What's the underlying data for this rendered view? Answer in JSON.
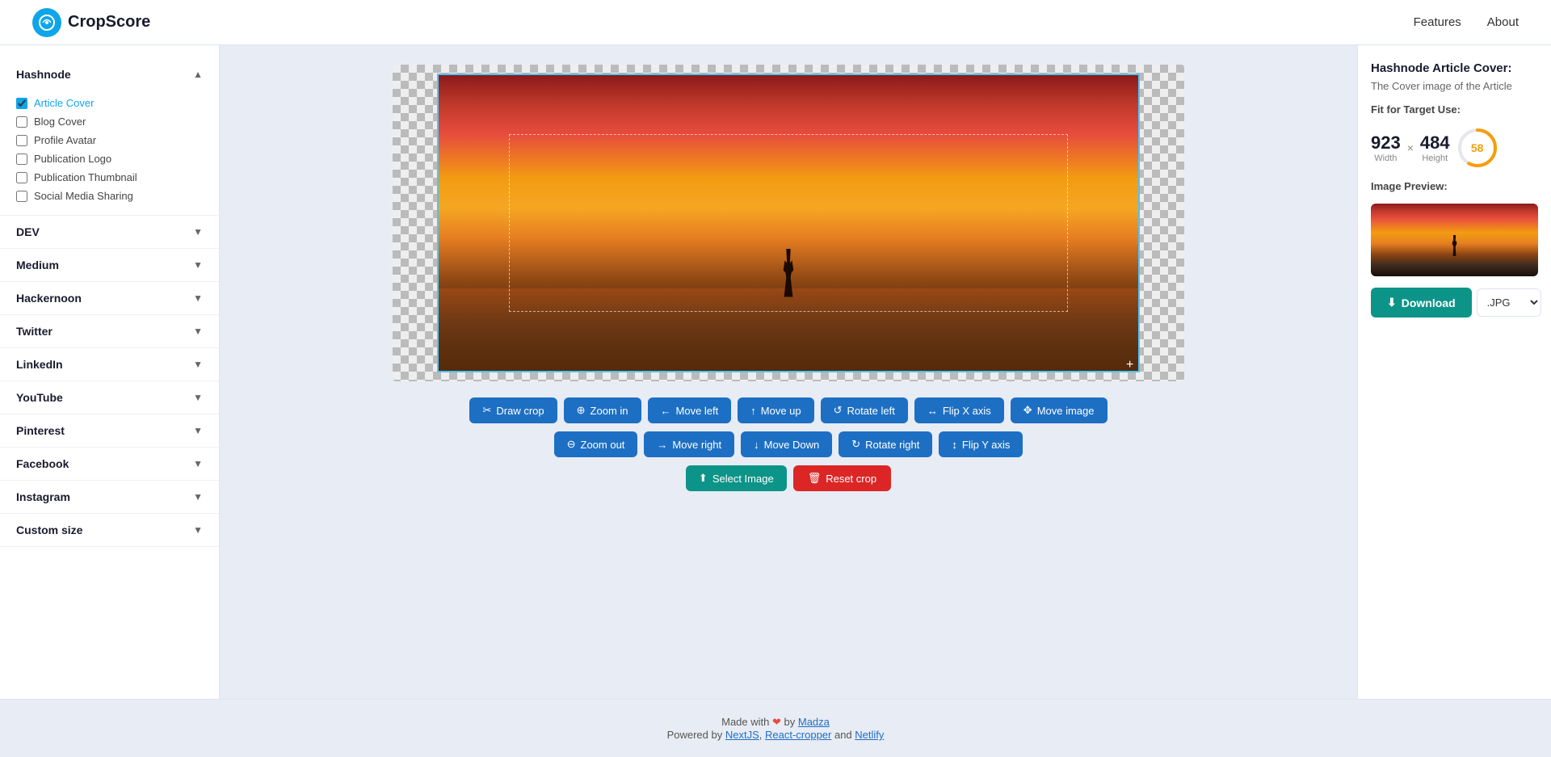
{
  "header": {
    "logo_text": "CropScore",
    "nav": [
      {
        "label": "Features",
        "id": "features"
      },
      {
        "label": "About",
        "id": "about"
      }
    ]
  },
  "sidebar": {
    "sections": [
      {
        "id": "hashnode",
        "label": "Hashnode",
        "expanded": true,
        "items": [
          {
            "label": "Article Cover",
            "checked": true
          },
          {
            "label": "Blog Cover",
            "checked": false
          },
          {
            "label": "Profile Avatar",
            "checked": false
          },
          {
            "label": "Publication Logo",
            "checked": false
          },
          {
            "label": "Publication Thumbnail",
            "checked": false
          },
          {
            "label": "Social Media Sharing",
            "checked": false
          }
        ]
      },
      {
        "id": "dev",
        "label": "DEV",
        "expanded": false,
        "items": []
      },
      {
        "id": "medium",
        "label": "Medium",
        "expanded": false,
        "items": []
      },
      {
        "id": "hackernoon",
        "label": "Hackernoon",
        "expanded": false,
        "items": []
      },
      {
        "id": "twitter",
        "label": "Twitter",
        "expanded": false,
        "items": []
      },
      {
        "id": "linkedin",
        "label": "LinkedIn",
        "expanded": false,
        "items": []
      },
      {
        "id": "youtube",
        "label": "YouTube",
        "expanded": false,
        "items": []
      },
      {
        "id": "pinterest",
        "label": "Pinterest",
        "expanded": false,
        "items": []
      },
      {
        "id": "facebook",
        "label": "Facebook",
        "expanded": false,
        "items": []
      },
      {
        "id": "instagram",
        "label": "Instagram",
        "expanded": false,
        "items": []
      },
      {
        "id": "custom",
        "label": "Custom size",
        "expanded": false,
        "items": []
      }
    ]
  },
  "toolbar": {
    "buttons_row1": [
      {
        "id": "draw-crop",
        "label": "Draw crop",
        "icon": "✂"
      },
      {
        "id": "zoom-in",
        "label": "Zoom in",
        "icon": "🔍"
      },
      {
        "id": "move-left",
        "label": "Move left",
        "icon": "←"
      },
      {
        "id": "move-up",
        "label": "Move up",
        "icon": "↑"
      },
      {
        "id": "rotate-left",
        "label": "Rotate left",
        "icon": "↺"
      },
      {
        "id": "flip-x",
        "label": "Flip X axis",
        "icon": "↔"
      },
      {
        "id": "move-image",
        "label": "Move image",
        "icon": "✥"
      }
    ],
    "buttons_row2": [
      {
        "id": "zoom-out",
        "label": "Zoom out",
        "icon": "🔍"
      },
      {
        "id": "move-right",
        "label": "Move right",
        "icon": "→"
      },
      {
        "id": "move-down",
        "label": "Move Down",
        "icon": "↓"
      },
      {
        "id": "rotate-right",
        "label": "Rotate right",
        "icon": "↻"
      },
      {
        "id": "flip-y",
        "label": "Flip Y axis",
        "icon": "↕"
      }
    ]
  },
  "actions": {
    "select_image": "Select Image",
    "reset_crop": "Reset crop"
  },
  "right_panel": {
    "title": "Hashnode Article Cover:",
    "subtitle": "The Cover image of the Article",
    "fit_label": "Fit for Target Use:",
    "width": "923",
    "width_label": "Width",
    "height": "484",
    "height_label": "Height",
    "score": "58",
    "image_preview_label": "Image Preview:",
    "download_label": "Download",
    "format": ".JPG"
  },
  "footer": {
    "line1_prefix": "Made with",
    "line1_by": " by ",
    "line1_author": "Madza",
    "line1_author_url": "#",
    "line2_prefix": "Powered by ",
    "line2_links": [
      {
        "label": "NextJS",
        "url": "#"
      },
      {
        "label": "React-cropper",
        "url": "#"
      },
      {
        "label": "Netlify",
        "url": "#"
      }
    ]
  }
}
